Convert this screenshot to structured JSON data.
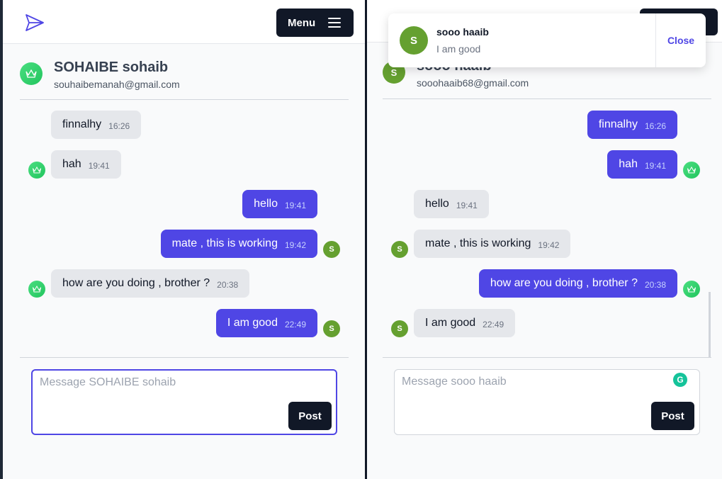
{
  "left_pane": {
    "menu_label": "Menu",
    "contact": {
      "name": "SOHAIBE sohaib",
      "email": "souhaibemanah@gmail.com"
    },
    "messages": [
      {
        "text": "finnalhy",
        "time": "16:26"
      },
      {
        "text": "hah",
        "time": "19:41"
      },
      {
        "text": "hello",
        "time": "19:41"
      },
      {
        "text": "mate , this is working",
        "time": "19:42"
      },
      {
        "text": "how are you doing , brother ?",
        "time": "20:38"
      },
      {
        "text": "I am good",
        "time": "22:49"
      }
    ],
    "avatar_initial": "S",
    "composer": {
      "placeholder": "Message SOHAIBE sohaib",
      "post_label": "Post"
    }
  },
  "right_pane": {
    "contact": {
      "name": "sooo haaib",
      "email": "sooohaaib68@gmail.com",
      "initial": "S"
    },
    "messages": [
      {
        "text": "finnalhy",
        "time": "16:26"
      },
      {
        "text": "hah",
        "time": "19:41"
      },
      {
        "text": "hello",
        "time": "19:41"
      },
      {
        "text": "mate , this is working",
        "time": "19:42"
      },
      {
        "text": "how are you doing , brother ?",
        "time": "20:38"
      },
      {
        "text": "I am good",
        "time": "22:49"
      }
    ],
    "avatar_initial": "S",
    "composer": {
      "placeholder": "Message sooo haaib",
      "post_label": "Post",
      "grammarly_letter": "G"
    }
  },
  "notification": {
    "initial": "S",
    "sender": "sooo haaib",
    "message": "I am good",
    "close_label": "Close"
  },
  "colors": {
    "accent": "#4f46e5",
    "dark": "#111827",
    "bubble_incoming": "#e5e7eb",
    "avatar_green": "#65a030",
    "avatar_teal": "#22c55e"
  },
  "icons": {
    "logo": "paper-plane-icon",
    "menu": "hamburger-icon",
    "contact_avatar": "crown-icon"
  }
}
